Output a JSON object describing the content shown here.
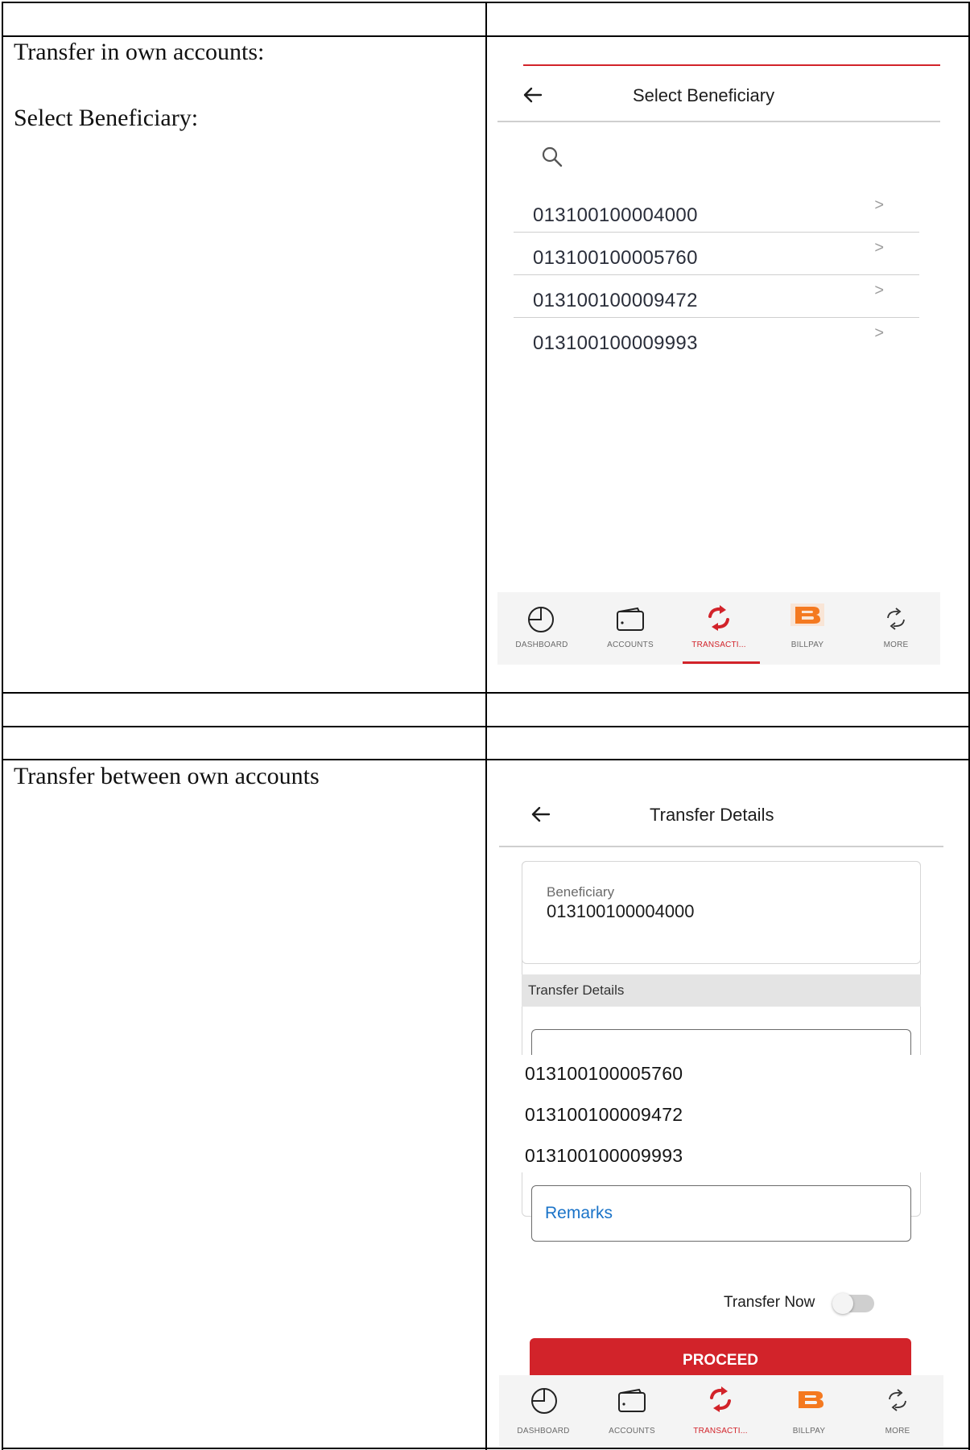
{
  "document": {
    "cell_row1_left": "Transfer in own accounts:",
    "cell_row1_left_sub": "Select Beneficiary:",
    "cell_row2_left": "Transfer between own accounts"
  },
  "screen1": {
    "title": "Select Beneficiary",
    "accounts": [
      "013100100004000",
      "013100100005760",
      "013100100009472",
      "013100100009993"
    ],
    "chevron": ">"
  },
  "screen2": {
    "title": "Transfer Details",
    "beneficiary_label": "Beneficiary",
    "beneficiary_value": "013100100004000",
    "section_label": "Transfer Details",
    "dropdown_options": [
      "013100100005760",
      "013100100009472",
      "013100100009993"
    ],
    "remarks_placeholder": "Remarks",
    "transfer_now_label": "Transfer Now",
    "transfer_now_on": false,
    "proceed_label": "PROCEED"
  },
  "bottom_nav": {
    "items": [
      {
        "label": "DASHBOARD",
        "icon": "dashboard-pie-icon"
      },
      {
        "label": "ACCOUNTS",
        "icon": "wallet-icon"
      },
      {
        "label": "TRANSACTI...",
        "icon": "transfer-arrows-icon"
      },
      {
        "label": "BILLPAY",
        "icon": "billpay-b-logo"
      },
      {
        "label": "MORE",
        "icon": "more-arrows-icon"
      }
    ],
    "active_index": 2
  },
  "colors": {
    "accent_red": "#d2232a",
    "billpay_orange": "#f47920",
    "link_blue": "#1a73c8"
  }
}
